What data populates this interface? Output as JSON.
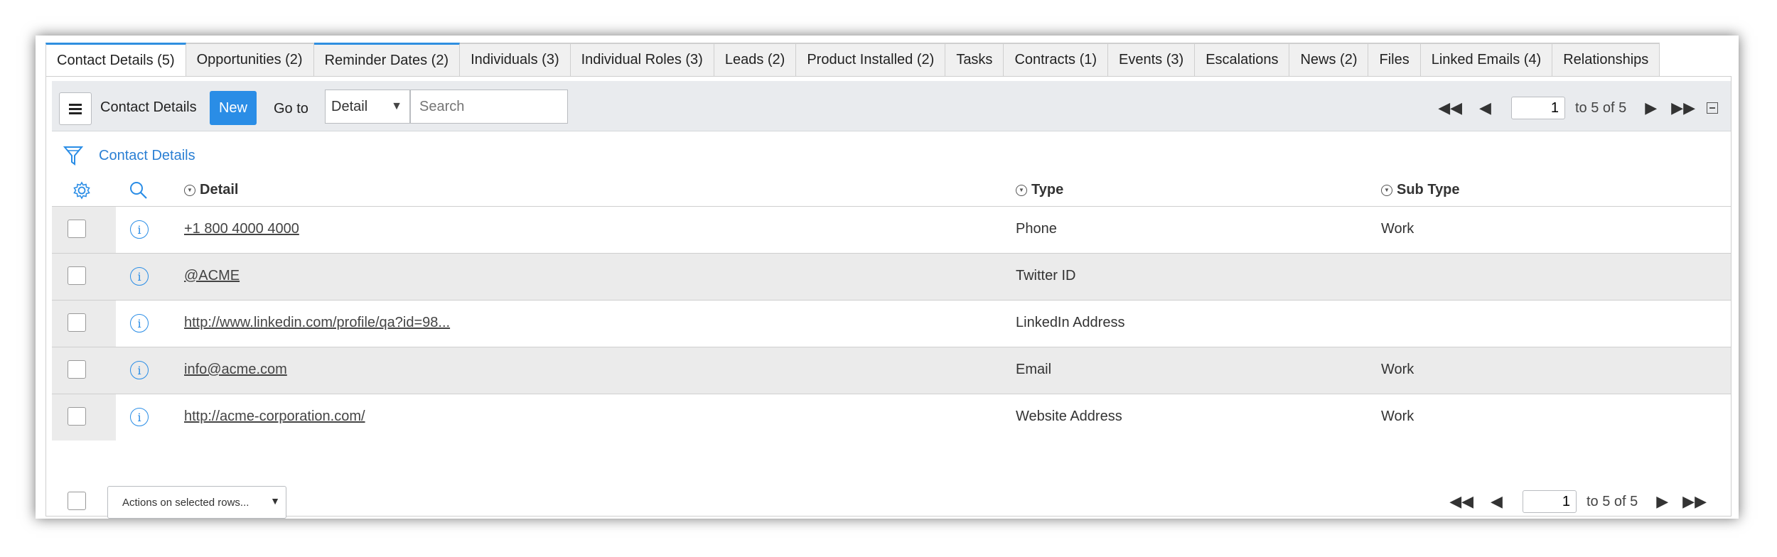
{
  "tabs": [
    {
      "label": "Contact Details (5)"
    },
    {
      "label": "Opportunities (2)"
    },
    {
      "label": "Reminder Dates (2)"
    },
    {
      "label": "Individuals (3)"
    },
    {
      "label": "Individual Roles (3)"
    },
    {
      "label": "Leads (2)"
    },
    {
      "label": "Product Installed (2)"
    },
    {
      "label": "Tasks"
    },
    {
      "label": "Contracts (1)"
    },
    {
      "label": "Events (3)"
    },
    {
      "label": "Escalations"
    },
    {
      "label": "News (2)"
    },
    {
      "label": "Files"
    },
    {
      "label": "Linked Emails (4)"
    },
    {
      "label": "Relationships"
    }
  ],
  "toolbar": {
    "title": "Contact Details",
    "new_label": "New",
    "goto_label": "Go to",
    "goto_select": "Detail",
    "search_placeholder": "Search"
  },
  "pager": {
    "page": "1",
    "range_text": "to 5 of 5"
  },
  "filter": {
    "label": "Contact Details"
  },
  "table": {
    "columns": [
      "Detail",
      "Type",
      "Sub Type"
    ],
    "rows": [
      {
        "detail": "+1 800 4000 4000",
        "type": "Phone",
        "subtype": "Work"
      },
      {
        "detail": "@ACME",
        "type": "Twitter ID",
        "subtype": ""
      },
      {
        "detail": "http://www.linkedin.com/profile/qa?id=98...",
        "type": "LinkedIn Address",
        "subtype": ""
      },
      {
        "detail": "info@acme.com",
        "type": "Email",
        "subtype": "Work"
      },
      {
        "detail": "http://acme-corporation.com/",
        "type": "Website Address",
        "subtype": "Work"
      }
    ]
  },
  "footer": {
    "actions_label": "Actions on selected rows..."
  },
  "colors": {
    "accent": "#2a8de6",
    "link": "#2a7fd4",
    "row_alt": "#ebebeb"
  }
}
